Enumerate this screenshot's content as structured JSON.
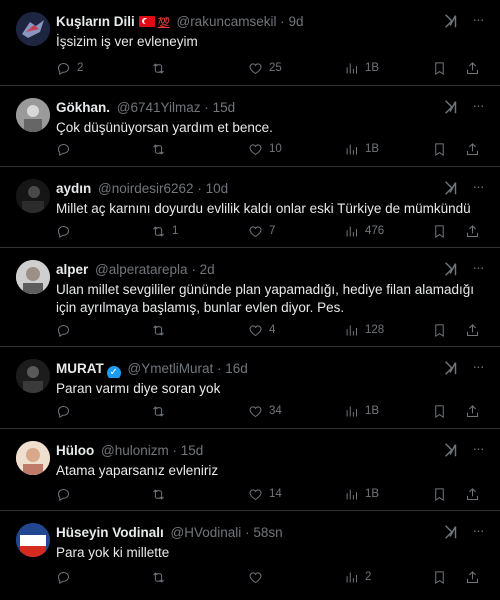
{
  "tweets": [
    {
      "name": "Kuşların Dili",
      "handle": "@rakuncamsekil",
      "time": "9d",
      "text": "İşsizim iş ver evleneyim",
      "replies": "2",
      "retweets": "",
      "likes": "25",
      "views": "1B",
      "flag": true,
      "hundred": "💯",
      "verified": false
    },
    {
      "name": "Gökhan.",
      "handle": "@6741Yilmaz",
      "time": "15d",
      "text": "Çok düşünüyorsan yardım et bence.",
      "replies": "",
      "retweets": "",
      "likes": "10",
      "views": "1B"
    },
    {
      "name": "aydın",
      "handle": "@noirdesir6262",
      "time": "10d",
      "text": "Millet aç karnını  doyurdu evlilik kaldı onlar eski Türkiye de mümkündü",
      "replies": "",
      "retweets": "1",
      "likes": "7",
      "views": "476"
    },
    {
      "name": "alper",
      "handle": "@alperatarepla",
      "time": "2d",
      "text": "Ulan millet sevgililer gününde plan yapamadığı, hediye filan alamadığı için ayrılmaya başlamış, bunlar evlen diyor. Pes.",
      "replies": "",
      "retweets": "",
      "likes": "4",
      "views": "128"
    },
    {
      "name": "MURAT",
      "handle": "@YmetliMurat",
      "time": "16d",
      "text": "Paran varmı diye soran yok",
      "replies": "",
      "retweets": "",
      "likes": "34",
      "views": "1B",
      "verified": true
    },
    {
      "name": "Hüloo",
      "handle": "@hulonizm",
      "time": "15d",
      "text": "Atama yaparsanız evleniriz",
      "replies": "",
      "retweets": "",
      "likes": "14",
      "views": "1B"
    },
    {
      "name": "Hüseyin Vodinalı",
      "handle": "@HVodinali",
      "time": "58sn",
      "text": "Para yok ki millette",
      "replies": "",
      "retweets": "",
      "likes": "",
      "views": "2"
    }
  ],
  "dot": "·",
  "icons": {
    "reply": "reply-icon",
    "retweet": "retweet-icon",
    "like": "heart-icon",
    "views": "views-icon",
    "bookmark": "bookmark-icon",
    "share": "share-icon",
    "grok": "grok-icon",
    "more": "more-icon"
  },
  "colors": {
    "background": "#000000",
    "text": "#e7e9ea",
    "muted": "#71767b",
    "divider": "#2f3336",
    "verified": "#1d9bf0"
  }
}
